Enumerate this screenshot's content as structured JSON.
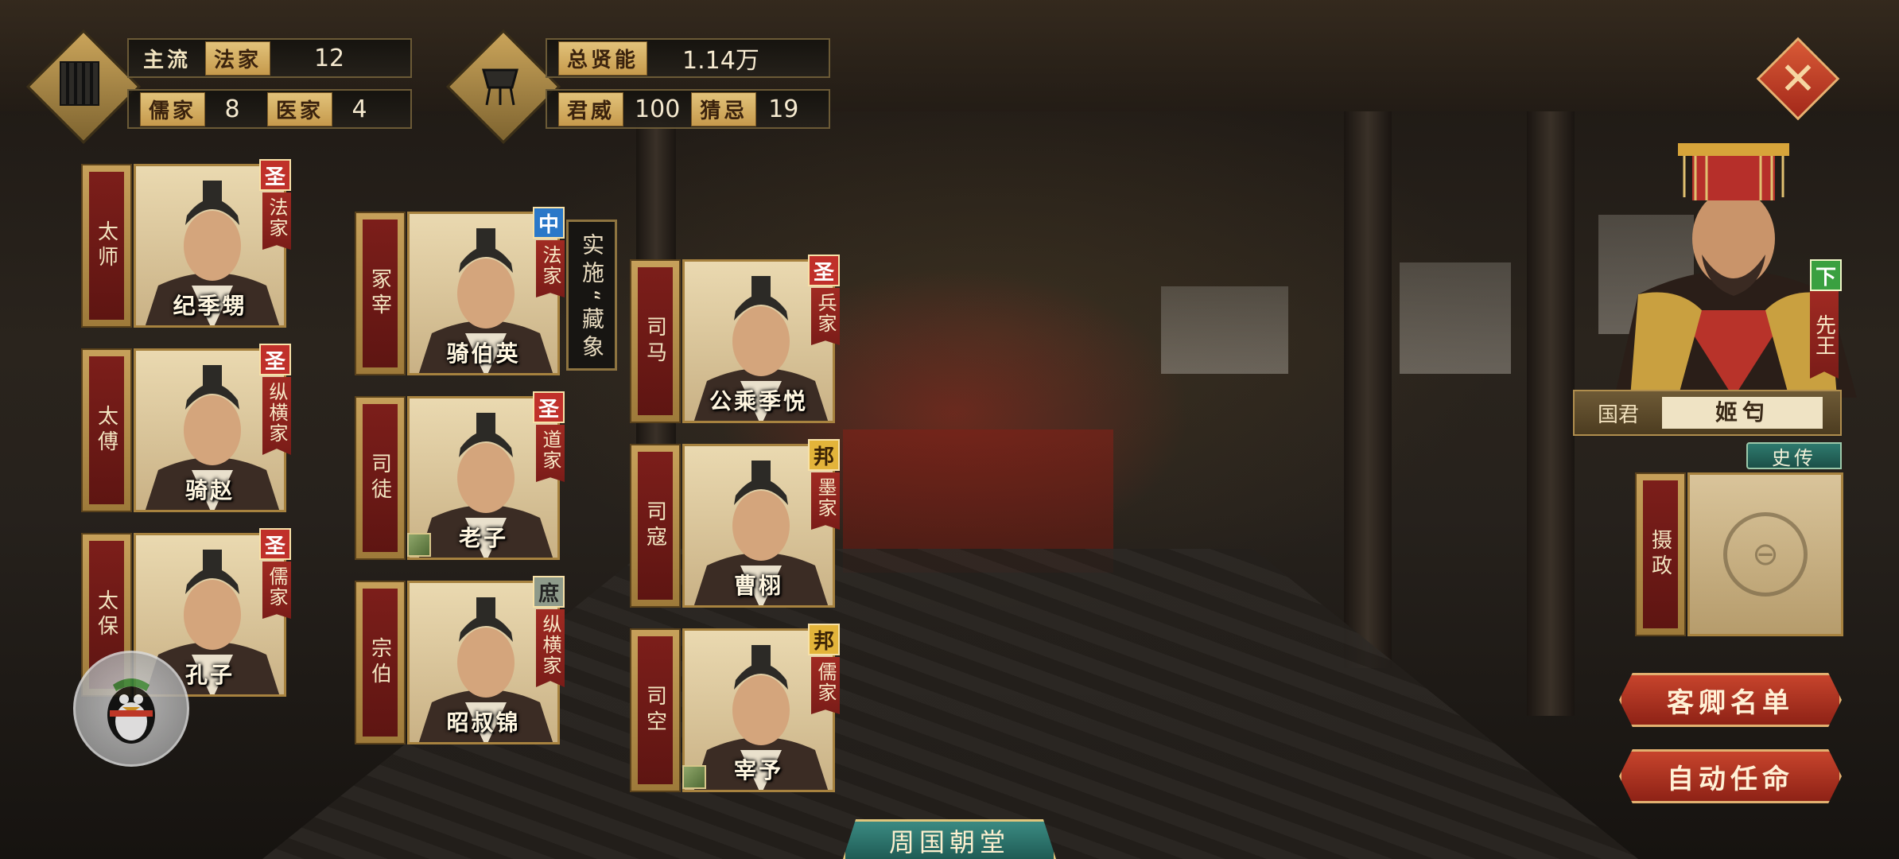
{
  "top_left": {
    "mainstream_label": "主流",
    "mainstream_value": "法家",
    "mainstream_count": "12",
    "school2_label": "儒家",
    "school2_count": "8",
    "school3_label": "医家",
    "school3_count": "4"
  },
  "top_center": {
    "total_talent_label": "总贤能",
    "total_talent_value": "1.14万",
    "prestige_label": "君威",
    "prestige_value": "100",
    "suspicion_label": "猜忌",
    "suspicion_value": "19"
  },
  "ministers": [
    {
      "title": "太师",
      "name": "纪季甥",
      "rank": "圣",
      "school": "法家"
    },
    {
      "title": "太傅",
      "name": "骑赵",
      "rank": "圣",
      "school": "纵横家"
    },
    {
      "title": "太保",
      "name": "孔子",
      "rank": "圣",
      "school": "儒家"
    },
    {
      "title": "冢宰",
      "name": "骑伯英",
      "rank": "中",
      "school": "法家"
    },
    {
      "title": "司徒",
      "name": "老子",
      "rank": "圣",
      "school": "道家"
    },
    {
      "title": "宗伯",
      "name": "昭叔锦",
      "rank": "庶",
      "school": "纵横家"
    },
    {
      "title": "司马",
      "name": "公乘季悦",
      "rank": "圣",
      "school": "兵家"
    },
    {
      "title": "司寇",
      "name": "曹栩",
      "rank": "邦",
      "school": "墨家"
    },
    {
      "title": "司空",
      "name": "宰予",
      "rank": "邦",
      "school": "儒家"
    }
  ],
  "policy_note": [
    "实",
    "施",
    "“",
    "藏",
    "象"
  ],
  "ruler": {
    "grade": "下",
    "title": "先王",
    "label": "国君",
    "name": "姬匄",
    "history_button": "史传"
  },
  "regent": {
    "title": "摄政"
  },
  "buttons": {
    "guest_list": "客卿名单",
    "auto_appoint": "自动任命"
  },
  "bottom_tab": "周国朝堂",
  "icons": {
    "close": "close-icon",
    "scroll": "bamboo-scroll-icon",
    "bronze": "bronze-vessel-icon",
    "penguin": "qq-penguin-icon"
  }
}
